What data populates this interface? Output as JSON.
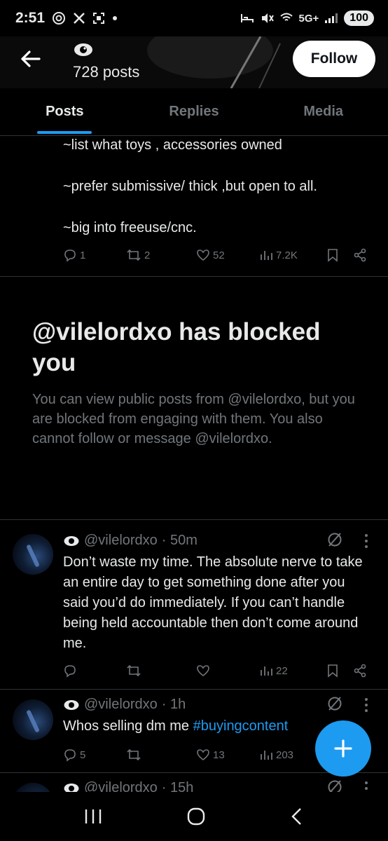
{
  "status_bar": {
    "time": "2:51",
    "network": "5G+",
    "battery": "100"
  },
  "header": {
    "posts_count": "728 posts",
    "follow_label": "Follow"
  },
  "tabs": [
    {
      "label": "Posts",
      "active": true
    },
    {
      "label": "Replies",
      "active": false
    },
    {
      "label": "Media",
      "active": false
    }
  ],
  "prev_post": {
    "lines": [
      "~list what toys , accessories owned",
      "~prefer submissive/ thick ,but open to all.",
      "~big into freeuse/cnc."
    ],
    "replies": "1",
    "reposts": "2",
    "likes": "52",
    "views": "7.2K"
  },
  "blocked": {
    "title": "@vilelordxo has blocked you",
    "body": "You can view public posts from @vilelordxo, but you are blocked from engaging with them. You also cannot follow or message @vilelordxo."
  },
  "tweets": [
    {
      "handle": "@vilelordxo",
      "time": "· 50m",
      "text": "Don’t waste my time. The absolute nerve to take an entire day to get something done after you said you’d do immediately. If you can’t handle being held accountable then don’t come around me.",
      "replies": "",
      "reposts": "",
      "likes": "",
      "views": "22"
    },
    {
      "handle": "@vilelordxo",
      "time": "· 1h",
      "text_prefix": "Whos selling  dm  me ",
      "hashtag": "#buyingcontent",
      "replies": "5",
      "reposts": "",
      "likes": "13",
      "views": "203"
    },
    {
      "handle": "@vilelordxo",
      "time": "· 15h"
    }
  ],
  "colors": {
    "accent": "#1d9bf0",
    "muted": "#71767b",
    "text": "#e7e9ea",
    "background": "#000000"
  }
}
